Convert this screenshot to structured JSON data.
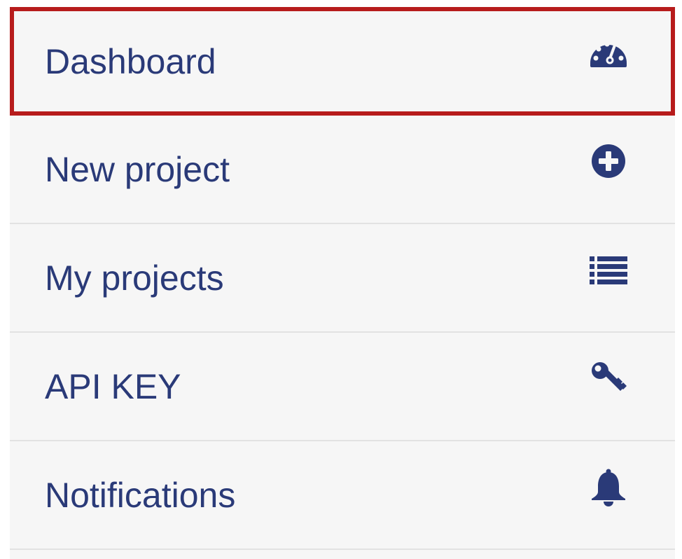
{
  "menu": {
    "items": [
      {
        "label": "Dashboard",
        "icon": "dashboard-gauge-icon",
        "active": true
      },
      {
        "label": "New project",
        "icon": "plus-circle-icon",
        "active": false
      },
      {
        "label": "My projects",
        "icon": "list-icon",
        "active": false
      },
      {
        "label": "API KEY",
        "icon": "key-icon",
        "active": false
      },
      {
        "label": "Notifications",
        "icon": "bell-icon",
        "active": false
      }
    ]
  },
  "colors": {
    "text": "#2a3a78",
    "background": "#f6f6f6",
    "highlight_border": "#b71c1c",
    "divider": "#e2e2e2"
  }
}
